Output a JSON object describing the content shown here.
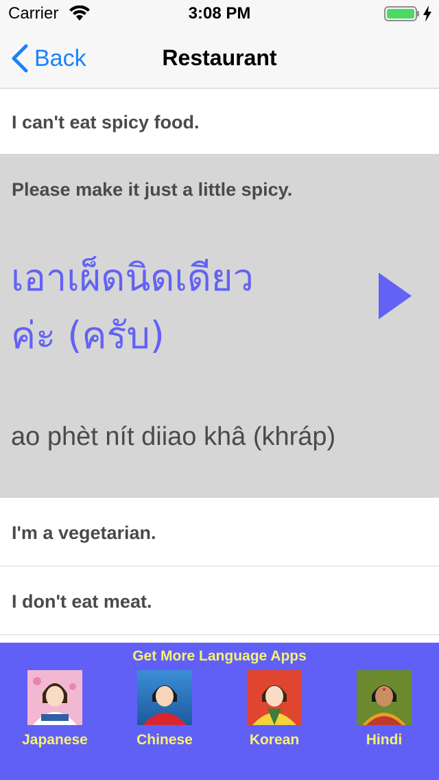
{
  "status_bar": {
    "carrier": "Carrier",
    "time": "3:08 PM",
    "icons": [
      "wifi-icon",
      "battery-icon",
      "charging-bolt-icon"
    ]
  },
  "nav": {
    "back_label": "Back",
    "title": "Restaurant",
    "accent_color": "#1a82fb"
  },
  "phrases": {
    "row1": "I can't eat spicy food.",
    "expanded": {
      "english": "Please make it just a little spicy.",
      "thai_line1": "เอาเผ็ดนิดเดียว",
      "thai_line2": "ค่ะ (ครับ)",
      "romanization": "ao phèt nít diiao khâ (khráp)",
      "play_icon": "play-icon",
      "thai_color": "#6262f5"
    },
    "row3": "I'm a vegetarian.",
    "row4": "I don't eat meat."
  },
  "promo": {
    "title": "Get More Language Apps",
    "background": "#6060f6",
    "text_color": "#f7f272",
    "apps": [
      {
        "label": "Japanese"
      },
      {
        "label": "Chinese"
      },
      {
        "label": "Korean"
      },
      {
        "label": "Hindi"
      }
    ]
  }
}
